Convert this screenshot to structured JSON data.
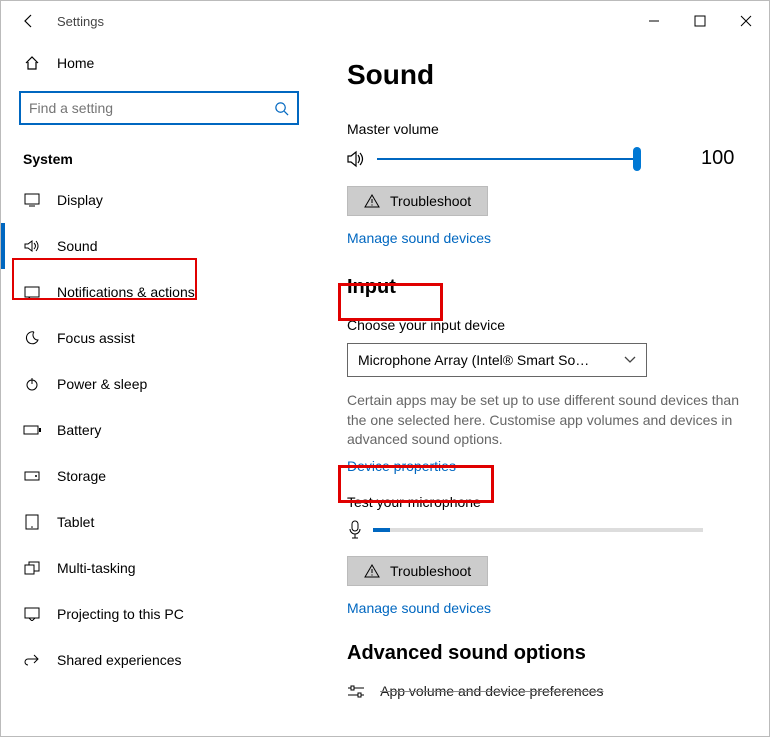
{
  "titlebar": {
    "title": "Settings"
  },
  "sidebar": {
    "home": "Home",
    "search_placeholder": "Find a setting",
    "section": "System",
    "items": [
      {
        "label": "Display"
      },
      {
        "label": "Sound"
      },
      {
        "label": "Notifications & actions"
      },
      {
        "label": "Focus assist"
      },
      {
        "label": "Power & sleep"
      },
      {
        "label": "Battery"
      },
      {
        "label": "Storage"
      },
      {
        "label": "Tablet"
      },
      {
        "label": "Multi-tasking"
      },
      {
        "label": "Projecting to this PC"
      },
      {
        "label": "Shared experiences"
      }
    ]
  },
  "main": {
    "title": "Sound",
    "master_volume_label": "Master volume",
    "master_volume_value": "100",
    "troubleshoot": "Troubleshoot",
    "manage_sound": "Manage sound devices",
    "input_heading": "Input",
    "choose_input": "Choose your input device",
    "input_device": "Microphone Array (Intel® Smart So…",
    "help_text": "Certain apps may be set up to use different sound devices than the one selected here. Customise app volumes and devices in advanced sound options.",
    "device_properties": "Device properties",
    "test_mic": "Test your microphone",
    "advanced_heading": "Advanced sound options",
    "cutoff": "App volume and device preferences"
  }
}
